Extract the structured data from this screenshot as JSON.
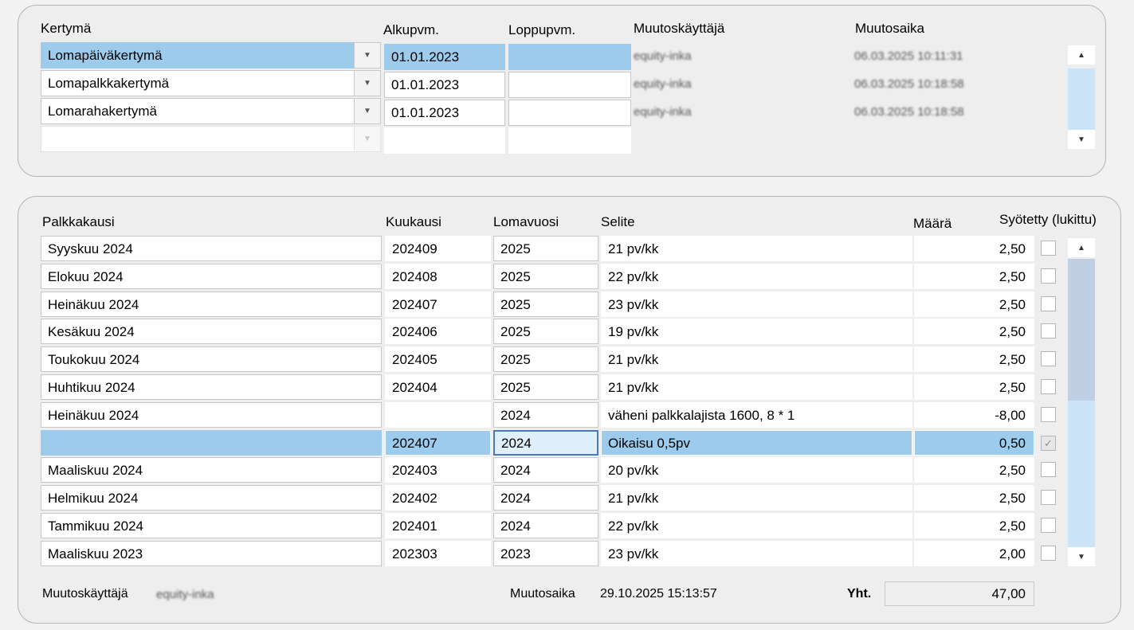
{
  "top": {
    "headers": {
      "kertyma": "Kertymä",
      "alkupvm": "Alkupvm.",
      "loppupvm": "Loppupvm.",
      "muutoskayttaja": "Muutoskäyttäjä",
      "muutosaika": "Muutosaika"
    },
    "rows": [
      {
        "kertyma": "Lomapäiväkertymä",
        "alkupvm": "01.01.2023",
        "loppupvm": "",
        "user": "equity-inka",
        "time": "06.03.2025 10:11:31"
      },
      {
        "kertyma": "Lomapalkkakertymä",
        "alkupvm": "01.01.2023",
        "loppupvm": "",
        "user": "equity-inka",
        "time": "06.03.2025 10:18:58"
      },
      {
        "kertyma": "Lomarahakertymä",
        "alkupvm": "01.01.2023",
        "loppupvm": "",
        "user": "equity-inka",
        "time": "06.03.2025 10:18:58"
      },
      {
        "kertyma": "",
        "alkupvm": "",
        "loppupvm": "",
        "user": "",
        "time": ""
      }
    ]
  },
  "bottom": {
    "headers": {
      "palkkakausi": "Palkkakausi",
      "kuukausi": "Kuukausi",
      "lomavuosi": "Lomavuosi",
      "selite": "Selite",
      "maara": "Määrä",
      "syotetty": "Syötetty (lukittu)"
    },
    "rows": [
      {
        "palkkakausi": "Syyskuu 2024",
        "kuukausi": "202409",
        "lomavuosi": "2025",
        "selite": "21 pv/kk",
        "maara": "2,50",
        "locked": false
      },
      {
        "palkkakausi": "Elokuu 2024",
        "kuukausi": "202408",
        "lomavuosi": "2025",
        "selite": "22 pv/kk",
        "maara": "2,50",
        "locked": false
      },
      {
        "palkkakausi": "Heinäkuu 2024",
        "kuukausi": "202407",
        "lomavuosi": "2025",
        "selite": "23 pv/kk",
        "maara": "2,50",
        "locked": false
      },
      {
        "palkkakausi": "Kesäkuu 2024",
        "kuukausi": "202406",
        "lomavuosi": "2025",
        "selite": "19 pv/kk",
        "maara": "2,50",
        "locked": false
      },
      {
        "palkkakausi": "Toukokuu 2024",
        "kuukausi": "202405",
        "lomavuosi": "2025",
        "selite": "21 pv/kk",
        "maara": "2,50",
        "locked": false
      },
      {
        "palkkakausi": "Huhtikuu 2024",
        "kuukausi": "202404",
        "lomavuosi": "2025",
        "selite": "21 pv/kk",
        "maara": "2,50",
        "locked": false
      },
      {
        "palkkakausi": "Heinäkuu 2024",
        "kuukausi": "",
        "lomavuosi": "2024",
        "selite": "väheni palkkalajista 1600, 8 * 1",
        "maara": "-8,00",
        "locked": false
      },
      {
        "palkkakausi": "",
        "kuukausi": "202407",
        "lomavuosi": "2024",
        "selite": "Oikaisu 0,5pv",
        "maara": "0,50",
        "locked": true
      },
      {
        "palkkakausi": "Maaliskuu 2024",
        "kuukausi": "202403",
        "lomavuosi": "2024",
        "selite": "20 pv/kk",
        "maara": "2,50",
        "locked": false
      },
      {
        "palkkakausi": "Helmikuu 2024",
        "kuukausi": "202402",
        "lomavuosi": "2024",
        "selite": "21 pv/kk",
        "maara": "2,50",
        "locked": false
      },
      {
        "palkkakausi": "Tammikuu 2024",
        "kuukausi": "202401",
        "lomavuosi": "2024",
        "selite": "22 pv/kk",
        "maara": "2,50",
        "locked": false
      },
      {
        "palkkakausi": "Maaliskuu 2023",
        "kuukausi": "202303",
        "lomavuosi": "2023",
        "selite": "23 pv/kk",
        "maara": "2,00",
        "locked": false
      }
    ],
    "footer": {
      "user_label": "Muutoskäyttäjä",
      "user_value": "equity-inka",
      "time_label": "Muutosaika",
      "time_value": "29.10.2025 15:13:57",
      "total_label": "Yht.",
      "total_value": "47,00"
    }
  },
  "icons": {
    "dropdown": "chevron-down-icon",
    "scroll_up": "arrow-up-icon",
    "scroll_down": "arrow-down-icon",
    "checkbox": "checkbox-icon"
  },
  "colors": {
    "selected_row": "#9ccbec",
    "scroll_track": "#cce4f7",
    "scroll_thumb": "#c0cfe3",
    "panel": "#eeeeee"
  }
}
